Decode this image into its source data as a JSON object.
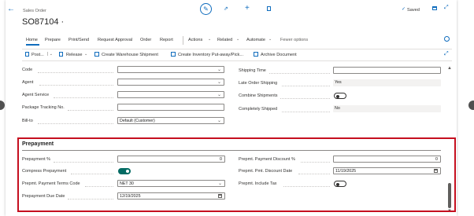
{
  "header": {
    "context": "Sales Order",
    "title": "SO87104 ·",
    "saved_label": "Saved"
  },
  "action_tabs": [
    "Home",
    "Prepare",
    "Print/Send",
    "Request Approval",
    "Order",
    "Report",
    "Actions",
    "Related",
    "Automate",
    "Fewer options"
  ],
  "action_bar": {
    "post": "Post...",
    "release": "Release",
    "warehouse": "Create Warehouse Shipment",
    "inventory": "Create Inventory Put-away/Pick...",
    "archive": "Archive Document"
  },
  "shipping": {
    "left": {
      "code": "Code",
      "agent": "Agent",
      "agent_service": "Agent Service",
      "tracking": "Package Tracking No.",
      "bill_to": "Bill-to",
      "bill_to_value": "Default (Customer)"
    },
    "right": {
      "shipping_time": "Shipping Time",
      "late_order": "Late Order Shipping",
      "late_order_value": "Yes",
      "combine": "Combine Shipments",
      "completely": "Completely Shipped",
      "completely_value": "No"
    }
  },
  "prepayment": {
    "title": "Prepayment",
    "left": {
      "pct": "Prepayment %",
      "pct_value": "0",
      "compress": "Compress Prepayment",
      "terms": "Prepmt. Payment Terms Code",
      "terms_value": "NET 30",
      "due": "Prepayment Due Date",
      "due_value": "12/19/2025"
    },
    "right": {
      "disc_pct": "Prepmt. Payment Discount %",
      "disc_pct_value": "0",
      "disc_date": "Prepmt. Pmt. Discount Date",
      "disc_date_value": "11/19/2025",
      "incl_tax": "Prepmt. Include Tax"
    }
  },
  "toggles": {
    "combine_shipments": false,
    "compress_prepayment": true,
    "include_tax": false
  },
  "colors": {
    "accent": "#036b63",
    "highlight_border": "#c50f1f",
    "link": "#0f6cbd"
  }
}
